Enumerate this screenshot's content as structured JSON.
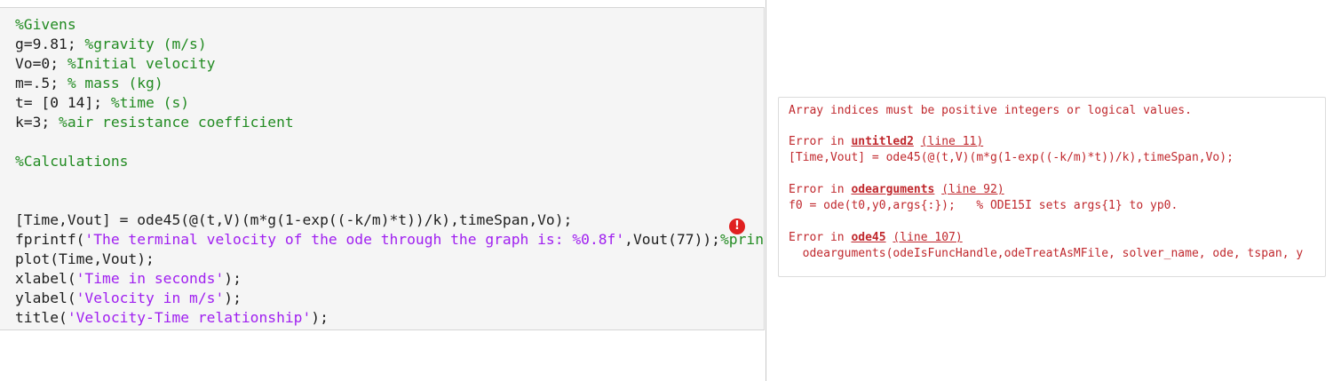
{
  "editor": {
    "lines": [
      [
        {
          "t": "%Givens",
          "c": "cm"
        }
      ],
      [
        {
          "t": "g=9.81; ",
          "c": ""
        },
        {
          "t": "%gravity (m/s)",
          "c": "cm"
        }
      ],
      [
        {
          "t": "Vo=0; ",
          "c": ""
        },
        {
          "t": "%Initial velocity",
          "c": "cm"
        }
      ],
      [
        {
          "t": "m=.5; ",
          "c": ""
        },
        {
          "t": "% mass (kg)",
          "c": "cm"
        }
      ],
      [
        {
          "t": "t= [0 14]; ",
          "c": ""
        },
        {
          "t": "%time (s)",
          "c": "cm"
        }
      ],
      [
        {
          "t": "k=3; ",
          "c": ""
        },
        {
          "t": "%air resistance coefficient",
          "c": "cm"
        }
      ],
      [
        {
          "t": "",
          "c": ""
        }
      ],
      [
        {
          "t": "%Calculations",
          "c": "cm"
        }
      ],
      [
        {
          "t": "",
          "c": ""
        }
      ],
      [
        {
          "t": "",
          "c": ""
        }
      ],
      [
        {
          "t": "[Time,Vout] = ode45(@(t,V)(m*g(1-exp((-k/m)*t))/k),timeSpan,Vo);",
          "c": ""
        }
      ],
      [
        {
          "t": "fprintf(",
          "c": ""
        },
        {
          "t": "'The terminal velocity of the ode through the graph is: %0.8f'",
          "c": "st"
        },
        {
          "t": ",Vout(77));",
          "c": ""
        },
        {
          "t": "%print",
          "c": "cm"
        }
      ],
      [
        {
          "t": "plot(Time,Vout);",
          "c": ""
        }
      ],
      [
        {
          "t": "xlabel(",
          "c": ""
        },
        {
          "t": "'Time in seconds'",
          "c": "st"
        },
        {
          "t": ");",
          "c": ""
        }
      ],
      [
        {
          "t": "ylabel(",
          "c": ""
        },
        {
          "t": "'Velocity in m/s'",
          "c": "st"
        },
        {
          "t": ");",
          "c": ""
        }
      ],
      [
        {
          "t": "title(",
          "c": ""
        },
        {
          "t": "'Velocity-Time relationship'",
          "c": "st"
        },
        {
          "t": ");",
          "c": ""
        }
      ]
    ],
    "error_indicator": "!",
    "error_line_index": 10
  },
  "output": {
    "message": "Array indices must be positive integers or logical values.",
    "stack": [
      {
        "prefix": "Error in ",
        "function": "untitled2",
        "location": "(line 11)",
        "code": "[Time,Vout] = ode45(@(t,V)(m*g(1-exp((-k/m)*t))/k),timeSpan,Vo);"
      },
      {
        "prefix": "Error in ",
        "function": "odearguments",
        "location": "(line 92)",
        "code": "f0 = ode(t0,y0,args{:});   % ODE15I sets args{1} to yp0."
      },
      {
        "prefix": "Error in ",
        "function": "ode45",
        "location": "(line 107)",
        "code": "  odearguments(odeIsFuncHandle,odeTreatAsMFile, solver_name, ode, tspan, y"
      }
    ]
  }
}
